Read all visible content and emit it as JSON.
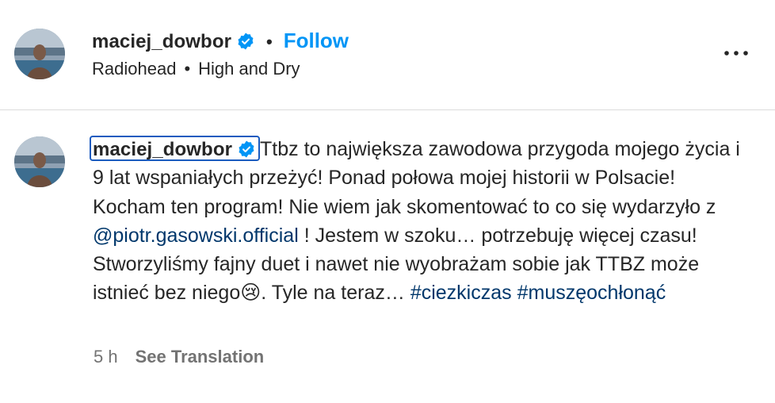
{
  "post": {
    "username": "maciej_dowbor",
    "separator": "•",
    "follow_label": "Follow",
    "music_artist": "Radiohead",
    "music_separator": "•",
    "music_title": "High and Dry"
  },
  "comment": {
    "username": "maciej_dowbor",
    "text_part1": "Ttbz to największa zawodowa przygoda mojego życia i 9 lat wspaniałych przeżyć! Ponad połowa mojej historii w Polsacie! Kocham ten program! Nie wiem jak skomentować to co się wydarzyło z ",
    "mention": "@piotr.gasowski.official",
    "text_part2": " ! Jestem w szoku… potrzebuję więcej czasu! Stworzyliśmy fajny duet i nawet nie wyobrażam sobie jak TTBZ może istnieć bez niego",
    "emoji": "😢",
    "text_part3": ". Tyle na teraz… ",
    "hashtag1": "#ciezkiczas",
    "hashtag2": "#muszęochłonąć",
    "time": "5 h",
    "translate_label": "See Translation"
  },
  "colors": {
    "accent": "#0095f6",
    "link": "#00376b",
    "secondary_text": "#737373",
    "verified": "#0095f6"
  },
  "icons": {
    "verified": "verified-badge-icon",
    "more": "more-options-icon"
  }
}
